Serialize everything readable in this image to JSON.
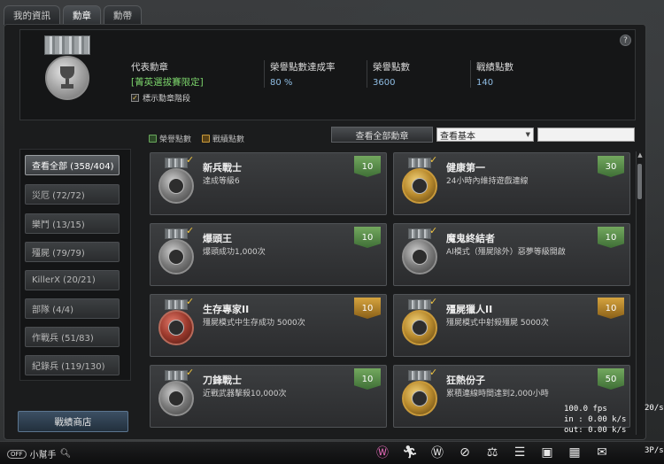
{
  "tabs": [
    {
      "label": "我的資訊"
    },
    {
      "label": "勳章"
    },
    {
      "label": "勳帶"
    }
  ],
  "help": "?",
  "rep": {
    "label": "代表勳章",
    "value": "[菁英選拔賽限定]",
    "check_label": "標示勳章階段",
    "check": "✓"
  },
  "stats": [
    {
      "label": "榮譽點數達成率",
      "value": "80 %"
    },
    {
      "label": "榮譽點數",
      "value": "3600"
    },
    {
      "label": "戰績點數",
      "value": "140"
    }
  ],
  "filter": {
    "honor_label": "榮譽點數",
    "record_label": "戰績點數",
    "view_all": "查看全部勳章",
    "select_value": "查看基本",
    "search_value": ""
  },
  "categories": [
    "查看全部 (358/404)",
    "災厄 (72/72)",
    "樂鬥 (13/15)",
    "殭屍 (79/79)",
    "KillerX (20/21)",
    "部隊 (4/4)",
    "作戰兵 (51/83)",
    "紀錄兵 (119/130)"
  ],
  "shop": "戰績商店",
  "medals": [
    {
      "title": "新兵戰士",
      "desc": "達成等級6",
      "points": "10",
      "type": "green",
      "check": "✓"
    },
    {
      "title": "健康第一",
      "desc": "24小時內維持遊戲連線",
      "points": "30",
      "type": "green",
      "check": "✓"
    },
    {
      "title": "爆頭王",
      "desc": "爆頭成功1,000次",
      "points": "10",
      "type": "green",
      "check": "✓"
    },
    {
      "title": "魔鬼終結者",
      "desc": "AI模式（殭屍除外）惡夢等級開啟",
      "points": "10",
      "type": "green",
      "check": "✓"
    },
    {
      "title": "生存專家II",
      "desc": "殭屍模式中生存成功 5000次",
      "points": "10",
      "type": "gold",
      "check": "✓"
    },
    {
      "title": "殭屍獵人II",
      "desc": "殭屍模式中射殺殭屍 5000次",
      "points": "10",
      "type": "gold",
      "check": "✓"
    },
    {
      "title": "刀鋒戰士",
      "desc": "近戰武器擊殺10,000次",
      "points": "10",
      "type": "green",
      "check": "✓"
    },
    {
      "title": "狂熱份子",
      "desc": "累積連線時間達到2,000小時",
      "points": "50",
      "type": "green",
      "check": "✓"
    }
  ],
  "bottom": {
    "helper": "小幫手",
    "pill": "OFF",
    "fps": "100.0 fps",
    "in": "in :  0.00 k/s",
    "out": "out:  0.00 k/s",
    "right_top": "20/s",
    "right_bottom": "3P/s"
  },
  "icons": [
    "pink-cart-icon",
    "running-icon",
    "w-icon",
    "compass-icon",
    "scale-icon",
    "menu-icon",
    "badge-icon",
    "calendar-icon",
    "mail-icon"
  ]
}
